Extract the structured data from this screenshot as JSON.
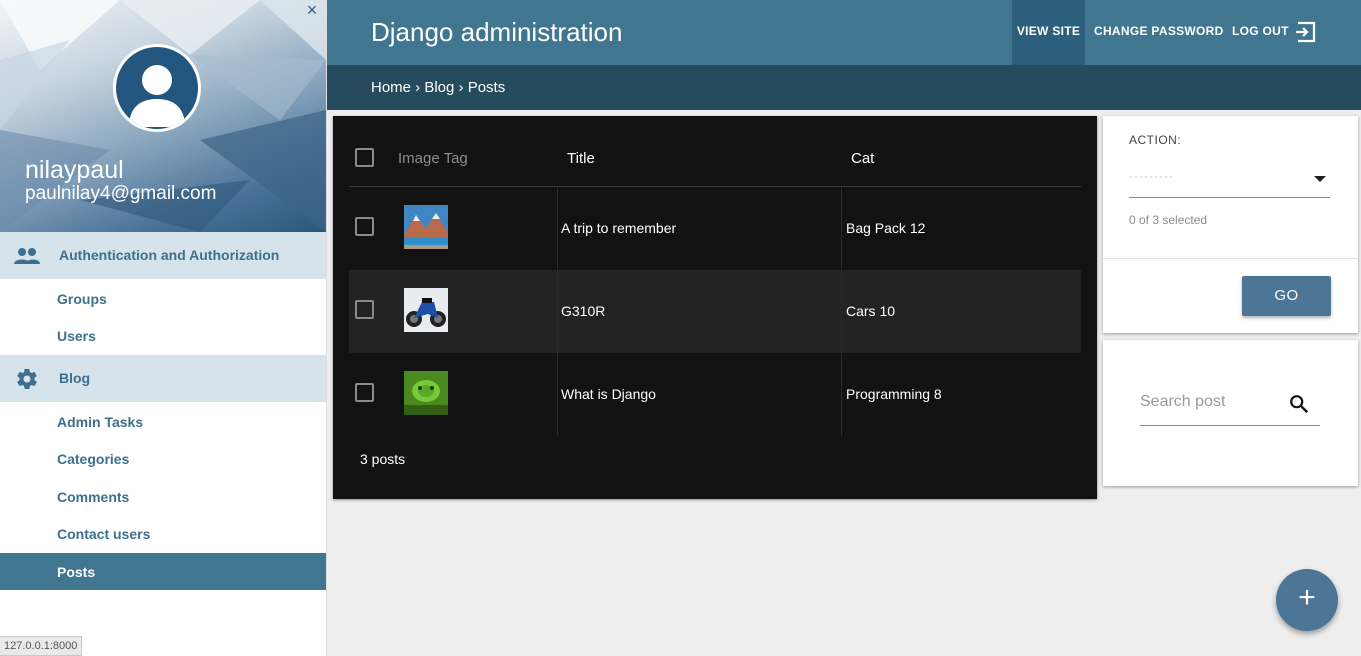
{
  "sidebar": {
    "close_icon": "×",
    "user": {
      "name": "nilaypaul",
      "email": "paulnilay4@gmail.com"
    },
    "sections": [
      {
        "label": "Authentication and Authorization",
        "icon": "people-icon",
        "items": [
          {
            "label": "Groups"
          },
          {
            "label": "Users"
          }
        ]
      },
      {
        "label": "Blog",
        "icon": "gear-icon",
        "items": [
          {
            "label": "Admin Tasks"
          },
          {
            "label": "Categories"
          },
          {
            "label": "Comments"
          },
          {
            "label": "Contact users"
          },
          {
            "label": "Posts",
            "active": true
          }
        ]
      }
    ]
  },
  "header": {
    "title": "Django administration",
    "links": {
      "view_site": "VIEW SITE",
      "change_password": "CHANGE PASSWORD",
      "logout": "LOG OUT"
    }
  },
  "breadcrumbs": "Home › Blog › Posts",
  "table": {
    "columns": [
      "Image Tag",
      "Title",
      "Cat"
    ],
    "rows": [
      {
        "title": "A trip to remember",
        "cat": "Bag Pack 12",
        "thumb": "mountain-lake-image"
      },
      {
        "title": "G310R",
        "cat": "Cars 10",
        "thumb": "motorcycle-image"
      },
      {
        "title": "What is Django",
        "cat": "Programming 8",
        "thumb": "green-snake-image"
      }
    ],
    "count": "3 posts"
  },
  "action": {
    "label": "ACTION:",
    "selected": "---------",
    "counter": "0 of 3 selected",
    "go": "GO"
  },
  "search": {
    "placeholder": "Search post"
  },
  "fab": {
    "label": "+"
  },
  "status_url": "127.0.0.1:8000",
  "colors": {
    "primary": "#417690",
    "breadcrumb": "#264b5d",
    "table_bg": "#121212",
    "sidebar_section": "#d6e3ea"
  }
}
